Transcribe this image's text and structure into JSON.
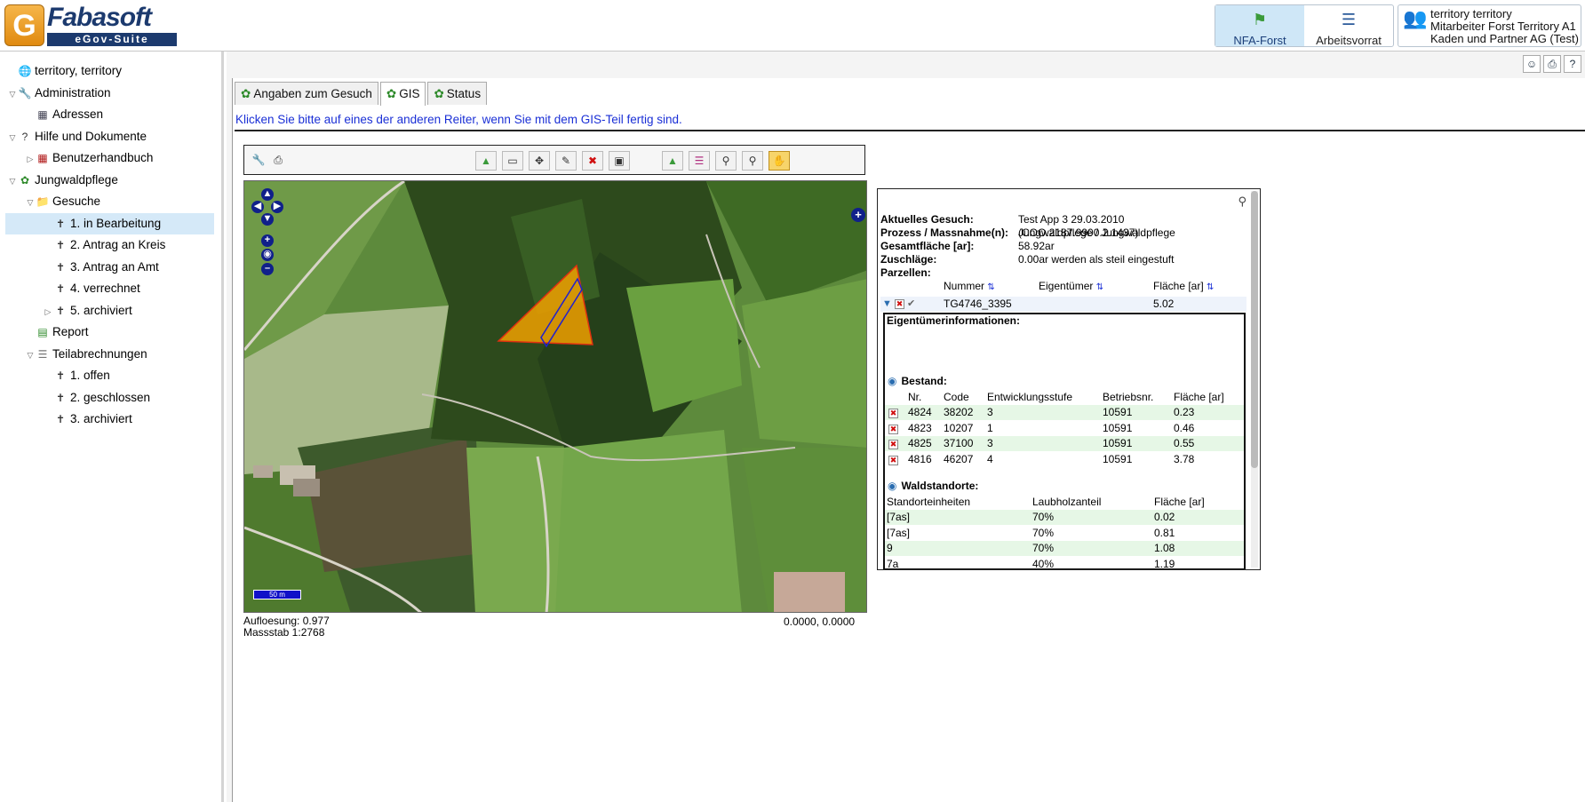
{
  "logo": {
    "name": "Fabasoft",
    "sub": "eGov-Suite"
  },
  "top_tabs": [
    {
      "label": "NFA-Forst",
      "icon": "forest-app-icon"
    },
    {
      "label": "Arbeitsvorrat",
      "icon": "worklist-icon"
    }
  ],
  "user": {
    "name": "territory territory",
    "role": "Mitarbeiter Forst Territory A1",
    "org": "Kaden und Partner AG (Test)"
  },
  "tree": [
    {
      "label": "territory, territory",
      "level": 0,
      "toggle": "",
      "icon": "globe-user-icon"
    },
    {
      "label": "Administration",
      "level": 0,
      "toggle": "open",
      "icon": "tools-icon"
    },
    {
      "label": "Adressen",
      "level": 1,
      "toggle": "",
      "icon": "address-book-icon"
    },
    {
      "label": "Hilfe und Dokumente",
      "level": 0,
      "toggle": "open",
      "icon": "help-icon"
    },
    {
      "label": "Benutzerhandbuch",
      "level": 1,
      "toggle": "closed",
      "icon": "manual-icon"
    },
    {
      "label": "Jungwaldpflege",
      "level": 0,
      "toggle": "open",
      "icon": "tree-icon"
    },
    {
      "label": "Gesuche",
      "level": 1,
      "toggle": "open",
      "icon": "folder-icon"
    },
    {
      "label": "1. in Bearbeitung",
      "level": 2,
      "toggle": "",
      "icon": "pin-icon",
      "selected": true
    },
    {
      "label": "2. Antrag an Kreis",
      "level": 2,
      "toggle": "",
      "icon": "pin-icon"
    },
    {
      "label": "3. Antrag an Amt",
      "level": 2,
      "toggle": "",
      "icon": "pin-icon"
    },
    {
      "label": "4. verrechnet",
      "level": 2,
      "toggle": "",
      "icon": "pin-icon"
    },
    {
      "label": "5. archiviert",
      "level": 2,
      "toggle": "closed",
      "icon": "pin-icon"
    },
    {
      "label": "Report",
      "level": 1,
      "toggle": "",
      "icon": "report-icon"
    },
    {
      "label": "Teilabrechnungen",
      "level": 1,
      "toggle": "open",
      "icon": "billing-icon"
    },
    {
      "label": "1. offen",
      "level": 2,
      "toggle": "",
      "icon": "pin-icon"
    },
    {
      "label": "2. geschlossen",
      "level": 2,
      "toggle": "",
      "icon": "pin-icon"
    },
    {
      "label": "3. archiviert",
      "level": 2,
      "toggle": "",
      "icon": "pin-icon"
    }
  ],
  "tabs": [
    {
      "label": "Angaben zum Gesuch",
      "active": false
    },
    {
      "label": "GIS",
      "active": true
    },
    {
      "label": "Status",
      "active": false
    }
  ],
  "hint": "Klicken Sie bitte auf eines der anderen Reiter, wenn Sie mit dem GIS-Teil fertig sind.",
  "map": {
    "resolution": "Aufloesung: 0.977",
    "scale": "Massstab 1:2768",
    "coords": "0.0000, 0.0000",
    "scale_bar": "50 m"
  },
  "panel": {
    "fields": [
      {
        "key": "Aktuelles Gesuch:",
        "value": "Test App 3 29.03.2010 (COO.2187.9900.2.1437)"
      },
      {
        "key": "Prozess / Massnahme(n):",
        "value": "Jungwaldpflege / Jungwaldpflege"
      },
      {
        "key": "Gesamtfläche [ar]:",
        "value": "58.92ar"
      },
      {
        "key": "Zuschläge:",
        "value": "0.00ar werden als steil eingestuft"
      },
      {
        "key": "Parzellen:",
        "value": ""
      }
    ],
    "parzellen_headers": [
      "Nummer",
      "Eigentümer",
      "Fläche [ar]"
    ],
    "parzelle": {
      "nummer": "TG4746_3395",
      "eigentuemer": "",
      "flaeche": "5.02"
    },
    "eigentuemer_title": "Eigentümerinformationen:",
    "bestand": {
      "title": "Bestand:",
      "headers": [
        "Nr.",
        "Code",
        "Entwicklungsstufe",
        "Betriebsnr.",
        "Fläche [ar]"
      ],
      "rows": [
        [
          "4824",
          "38202",
          "3",
          "10591",
          "0.23"
        ],
        [
          "4823",
          "10207",
          "1",
          "10591",
          "0.46"
        ],
        [
          "4825",
          "37100",
          "3",
          "10591",
          "0.55"
        ],
        [
          "4816",
          "46207",
          "4",
          "10591",
          "3.78"
        ]
      ]
    },
    "waldstandorte": {
      "title": "Waldstandorte:",
      "headers": [
        "Standorteinheiten",
        "Laubholzanteil",
        "Fläche [ar]"
      ],
      "rows": [
        [
          "[7as]",
          "70%",
          "0.02"
        ],
        [
          "[7as]",
          "70%",
          "0.81"
        ],
        [
          "9",
          "70%",
          "1.08"
        ],
        [
          "7a",
          "40%",
          "1.19"
        ]
      ]
    }
  }
}
